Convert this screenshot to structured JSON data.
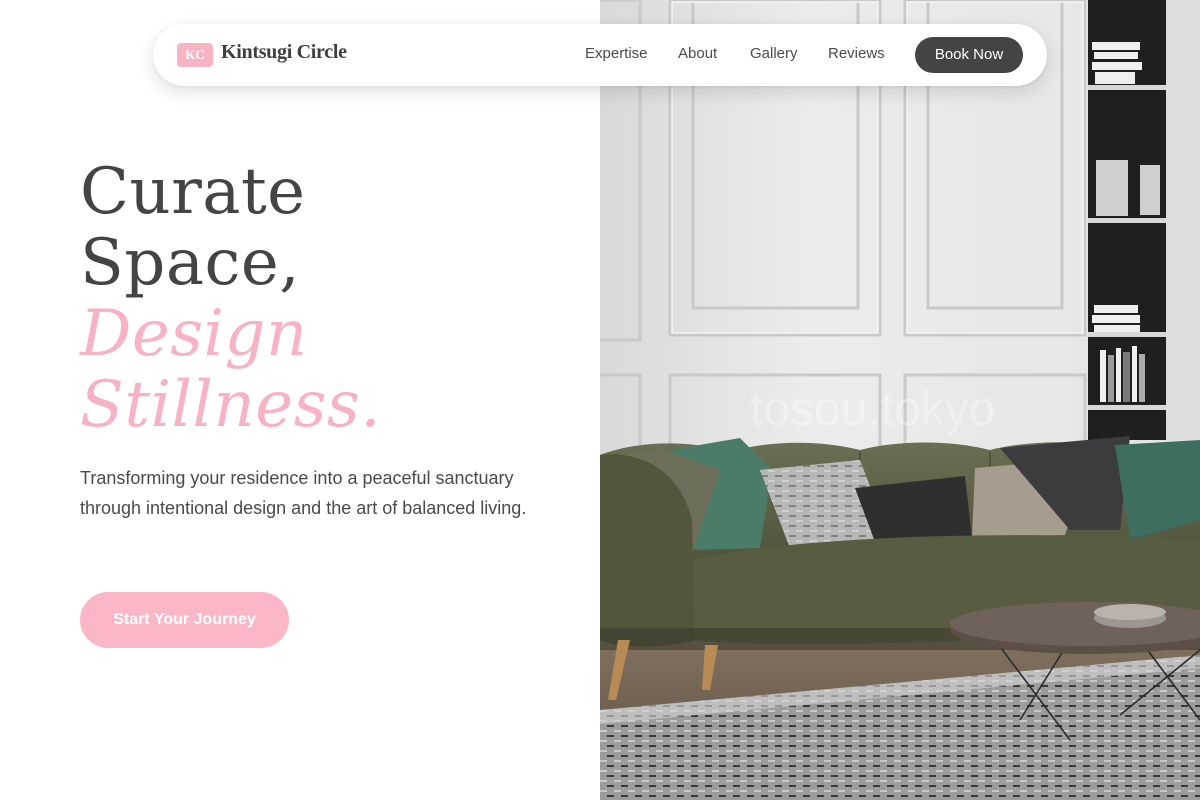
{
  "brand": {
    "badge": "KC",
    "name": "Kintsugi Circle"
  },
  "nav": {
    "links": [
      "Expertise",
      "About",
      "Gallery",
      "Reviews"
    ],
    "cta_label": "Book Now"
  },
  "hero": {
    "headline_line1": "Curate",
    "headline_line2": "Space,",
    "headline_accent_line1": "Design",
    "headline_accent_line2": "Stillness.",
    "subtitle": "Transforming your residence into a peaceful sanctuary through intentional design and the art of balanced living.",
    "cta_label": "Start Your Journey",
    "image_watermark": "tosou.tokyo"
  },
  "colors": {
    "accent_pink": "#f7b3c4",
    "text_dark": "#444444",
    "button_dark": "#444444",
    "sofa_green": "#5c6146",
    "wall": "#e9e9e9"
  },
  "icons": [
    "kc-logo-badge"
  ]
}
